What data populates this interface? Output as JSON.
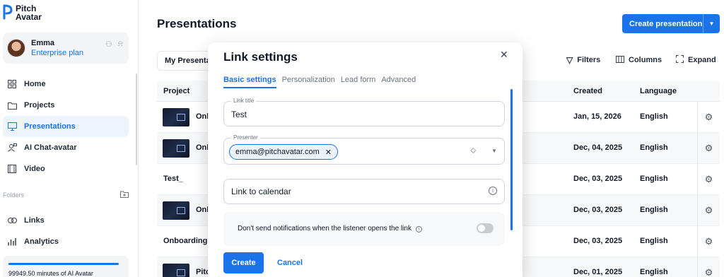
{
  "brand": {
    "name_line1": "Pitch",
    "name_line2": "Avatar",
    "accent": "#1a73e8"
  },
  "user": {
    "name": "Emma",
    "plan": "Enterprise plan"
  },
  "nav": [
    {
      "label": "Home",
      "icon": "grid-icon"
    },
    {
      "label": "Projects",
      "icon": "folder-icon"
    },
    {
      "label": "Presentations",
      "icon": "monitor-icon",
      "active": true
    },
    {
      "label": "AI Chat-avatar",
      "icon": "chat-avatar-icon"
    },
    {
      "label": "Video",
      "icon": "film-icon"
    }
  ],
  "folders": {
    "label": "Folders"
  },
  "nav2": [
    {
      "label": "Links",
      "icon": "link-icon"
    },
    {
      "label": "Analytics",
      "icon": "bar-chart-icon"
    }
  ],
  "minutes": {
    "text": "99949.50 minutes of AI Avatar",
    "used_fraction": 0.96
  },
  "page": {
    "title": "Presentations"
  },
  "create_button": {
    "label": "Create presentation"
  },
  "view_selector": {
    "label": "My Presentat"
  },
  "toolbar": {
    "filters": "Filters",
    "columns": "Columns",
    "expand": "Expand"
  },
  "table": {
    "headers": {
      "project": "Project",
      "created": "Created",
      "language": "Language"
    },
    "rows": [
      {
        "name": "Onb",
        "thumb": true,
        "created": "Jan, 15, 2026",
        "language": "English"
      },
      {
        "name": "Onb",
        "thumb": true,
        "created": "Dec, 04, 2025",
        "language": "English"
      },
      {
        "name": "Test_",
        "thumb": false,
        "created": "Dec, 03, 2025",
        "language": "English"
      },
      {
        "name": "Onb",
        "thumb": true,
        "created": "Dec, 03, 2025",
        "language": "English"
      },
      {
        "name": "Onboarding m",
        "thumb": false,
        "created": "Dec, 03, 2025",
        "language": "English"
      },
      {
        "name": "Pitc",
        "thumb": true,
        "created": "Dec, 01, 2025",
        "language": "English"
      }
    ]
  },
  "modal": {
    "title": "Link settings",
    "tabs": [
      "Basic settings",
      "Personalization",
      "Lead form",
      "Advanced"
    ],
    "active_tab": "Basic settings",
    "link_title": {
      "label": "Link title",
      "value": "Test"
    },
    "presenter": {
      "label": "Presenter",
      "chip": "emma@pitchavatar.com"
    },
    "calendar": {
      "placeholder": "Link to calendar"
    },
    "notification": {
      "text": "Don't send notifications when the listener opens the link",
      "enabled": false
    },
    "create_label": "Create",
    "cancel_label": "Cancel"
  }
}
